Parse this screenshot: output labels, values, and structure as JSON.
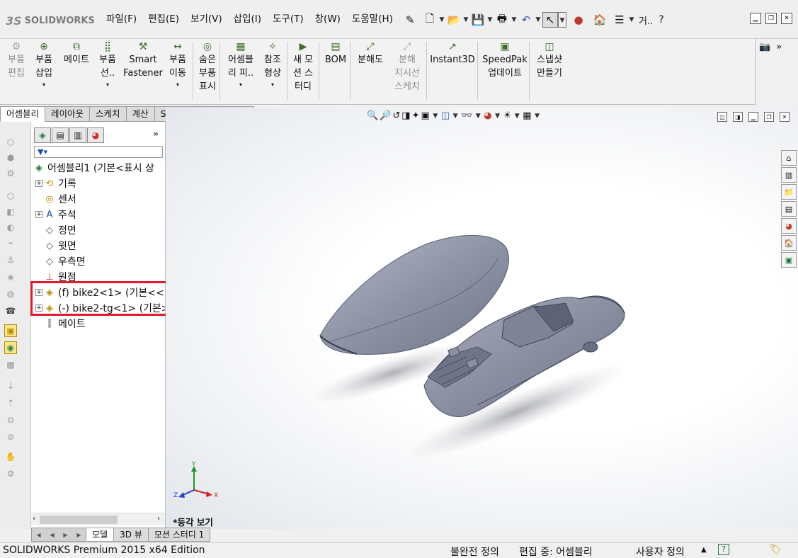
{
  "app": {
    "logo_text": "SOLIDWORKS",
    "edition": "SOLIDWORKS Premium 2015 x64 Edition"
  },
  "menu": [
    "파일(F)",
    "편집(E)",
    "보기(V)",
    "삽입(I)",
    "도구(T)",
    "창(W)",
    "도움말(H)"
  ],
  "search_hint": "거..",
  "help_icon": "?",
  "ribbon": [
    {
      "label": "부품\n편집",
      "icon": "edit-component-icon",
      "disabled": true
    },
    {
      "label": "부품\n삽입",
      "icon": "insert-component-icon",
      "disabled": false,
      "arrow": true
    },
    {
      "label": "메이트",
      "icon": "mate-icon",
      "disabled": false
    },
    {
      "label": "부품\n선..",
      "icon": "linear-pattern-icon",
      "disabled": false,
      "arrow": true
    },
    {
      "label": "Smart\nFastener",
      "icon": "smart-fastener-icon",
      "disabled": false
    },
    {
      "label": "부품\n이동",
      "icon": "move-component-icon",
      "disabled": false,
      "arrow": true
    },
    {
      "label": "숨은\n부품\n표시",
      "icon": "show-hidden-icon",
      "disabled": false
    },
    {
      "label": "어셈블\n리 피..",
      "icon": "assembly-feature-icon",
      "disabled": false,
      "arrow": true
    },
    {
      "label": "참조\n형상",
      "icon": "reference-geometry-icon",
      "disabled": false,
      "arrow": true
    },
    {
      "label": "새 모\n션 스\n터디",
      "icon": "new-motion-study-icon",
      "disabled": false
    },
    {
      "label": "BOM",
      "icon": "bom-icon",
      "disabled": false
    },
    {
      "label": "분해도",
      "icon": "exploded-view-icon",
      "disabled": false
    },
    {
      "label": "분해\n지시선\n스케치",
      "icon": "explode-line-sketch-icon",
      "disabled": true
    },
    {
      "label": "Instant3D",
      "icon": "instant3d-icon",
      "disabled": false
    },
    {
      "label": "SpeedPak\n업데이트",
      "icon": "speedpak-icon",
      "disabled": false
    },
    {
      "label": "스냅샷\n만들기",
      "icon": "snapshot-icon",
      "disabled": false
    }
  ],
  "command_tabs": [
    "어셈블리",
    "레이아웃",
    "스케치",
    "계산",
    "SOLIDWORKS 애드인"
  ],
  "tree": {
    "root": "어셈블리1 (기본<표시 상",
    "items": [
      {
        "label": "기록",
        "icon": "history-icon",
        "expand": true
      },
      {
        "label": "센서",
        "icon": "sensor-icon",
        "expand": false
      },
      {
        "label": "주석",
        "icon": "annotation-icon",
        "expand": true
      },
      {
        "label": "정면",
        "icon": "plane-icon",
        "expand": false
      },
      {
        "label": "윗면",
        "icon": "plane-icon",
        "expand": false
      },
      {
        "label": "우측면",
        "icon": "plane-icon",
        "expand": false
      },
      {
        "label": "원점",
        "icon": "origin-icon",
        "expand": false
      },
      {
        "label": "(f) bike2<1> (기본<<",
        "icon": "part-icon",
        "expand": true
      },
      {
        "label": "(-) bike2-tg<1> (기본>",
        "icon": "part-icon",
        "expand": true
      },
      {
        "label": "메이트",
        "icon": "mates-folder-icon",
        "expand": false
      }
    ]
  },
  "viewport": {
    "view_label": "*등각 보기",
    "triad": {
      "x": "X",
      "y": "Y",
      "z": "Z"
    }
  },
  "bottom_tabs": [
    "모델",
    "3D 뷰",
    "모션 스터디 1"
  ],
  "status": {
    "definition": "불완전 정의",
    "editing": "편집 중: 어셈블리",
    "units": "사용자 정의"
  },
  "colors": {
    "highlight": "#e21a2d",
    "part_body": "#8e93a6"
  }
}
